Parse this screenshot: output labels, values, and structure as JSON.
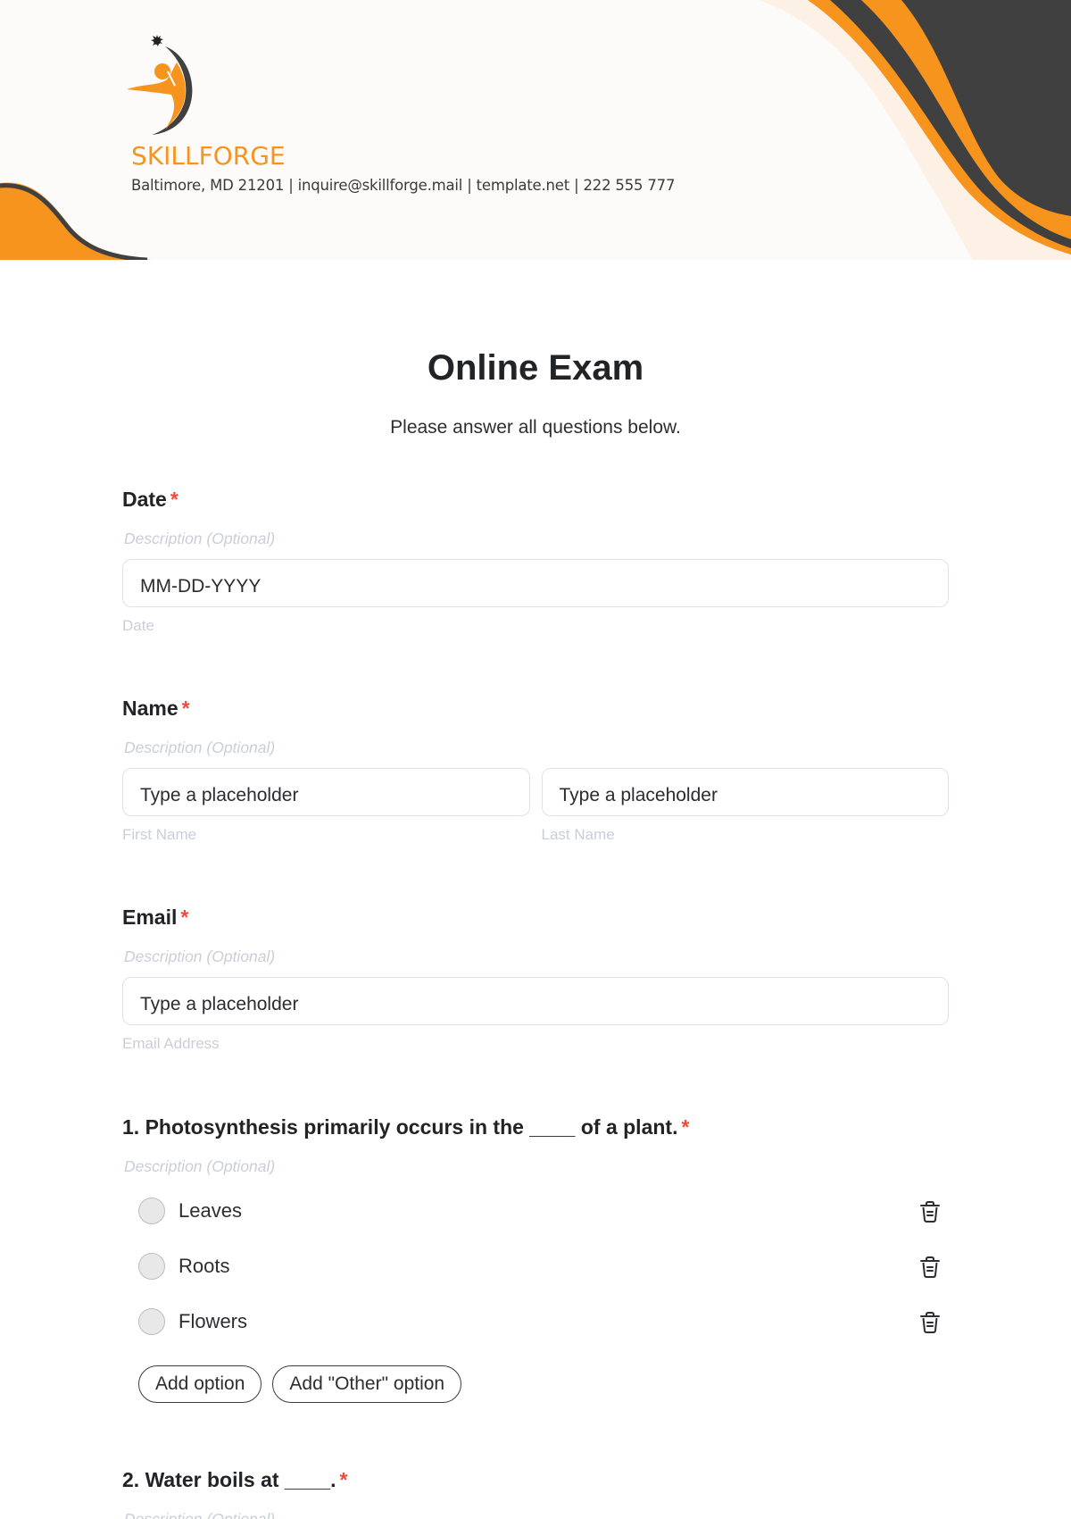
{
  "header": {
    "brand": "SKILLFORGE",
    "contact": "Baltimore, MD 21201 | inquire@skillforge.mail | template.net | 222 555 777",
    "colors": {
      "accent": "#f7941d",
      "dark": "#404041",
      "cream": "#fdf1e6"
    }
  },
  "form": {
    "title": "Online Exam",
    "subtitle": "Please answer all questions below.",
    "required_mark": "*",
    "fields": {
      "date": {
        "label": "Date",
        "description": "Description (Optional)",
        "placeholder": "MM-DD-YYYY",
        "sublabel": "Date"
      },
      "name": {
        "label": "Name",
        "description": "Description (Optional)",
        "first_placeholder": "Type a placeholder",
        "last_placeholder": "Type a placeholder",
        "first_sublabel": "First Name",
        "last_sublabel": "Last Name"
      },
      "email": {
        "label": "Email",
        "description": "Description (Optional)",
        "placeholder": "Type a placeholder",
        "sublabel": "Email Address"
      }
    },
    "questions": [
      {
        "label": "1. Photosynthesis primarily occurs in the ____ of a plant.",
        "description": "Description (Optional)",
        "options": [
          "Leaves",
          "Roots",
          "Flowers"
        ],
        "add_option": "Add option",
        "add_other_option": "Add \"Other\" option"
      },
      {
        "label": "2. Water boils at ____.",
        "description": "Description (Optional)"
      }
    ]
  }
}
